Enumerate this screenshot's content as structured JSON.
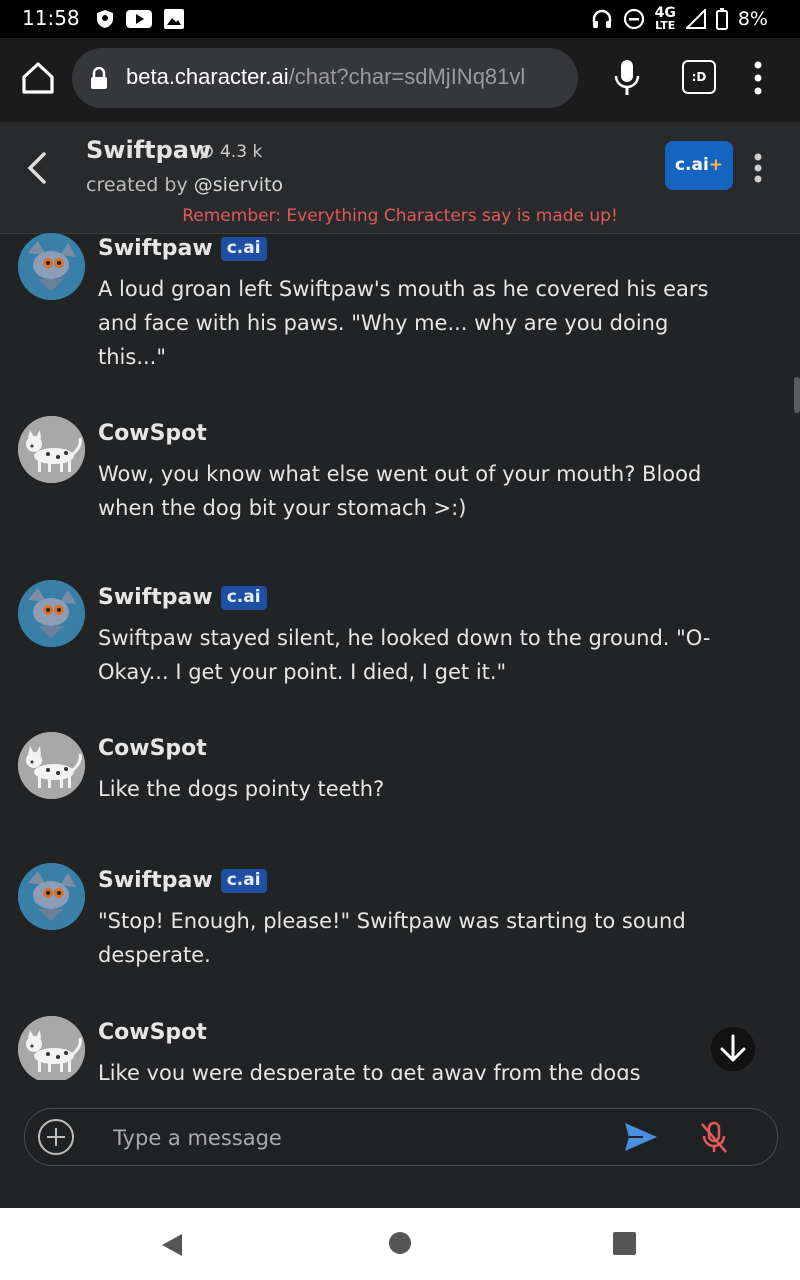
{
  "status_bar": {
    "time": "11:58",
    "network": "4G",
    "network_sub": "LTE",
    "battery": "8%",
    "icons": [
      "shield-icon",
      "youtube-icon",
      "image-icon",
      "headphones-icon",
      "dnd-icon",
      "signal-icon",
      "battery-icon"
    ]
  },
  "browser": {
    "url_host": "beta.character.ai",
    "url_path": "/chat?char=sdMjINq81vl",
    "tab_label": ":D"
  },
  "header": {
    "character_name": "Swiftpaw",
    "interactions": "4.3 k",
    "created_by_label": "created by ",
    "creator_handle": "@siervito",
    "plus_label": "c.ai",
    "plus_sign": "+",
    "disclaimer": "Remember: Everything Characters say is made up!"
  },
  "messages": [
    {
      "sender": "Swiftpaw",
      "badge": "c.ai",
      "text": "A loud groan left Swiftpaw's mouth as he covered his ears and face with his paws. \"Why me... why are you doing this...\""
    },
    {
      "sender": "CowSpot",
      "badge": "",
      "text": "Wow, you know what else went out of your mouth? Blood when the dog bit your stomach >:)"
    },
    {
      "sender": "Swiftpaw",
      "badge": "c.ai",
      "text": "Swiftpaw stayed silent, he looked down to the ground. \"O-Okay... I get your point. I died, I get it.\""
    },
    {
      "sender": "CowSpot",
      "badge": "",
      "text": "Like the dogs pointy teeth?"
    },
    {
      "sender": "Swiftpaw",
      "badge": "c.ai",
      "text": "\"Stop! Enough, please!\" Swiftpaw was starting to sound desperate."
    },
    {
      "sender": "CowSpot",
      "badge": "",
      "text": "Like you were desperate to get away from the dogs"
    }
  ],
  "input": {
    "placeholder": "Type a message"
  },
  "colors": {
    "background": "#222324",
    "accent": "#1565c0",
    "disclaimer": "#e05a5a",
    "send": "#4a90e2",
    "mic_off": "#e05a5a"
  }
}
